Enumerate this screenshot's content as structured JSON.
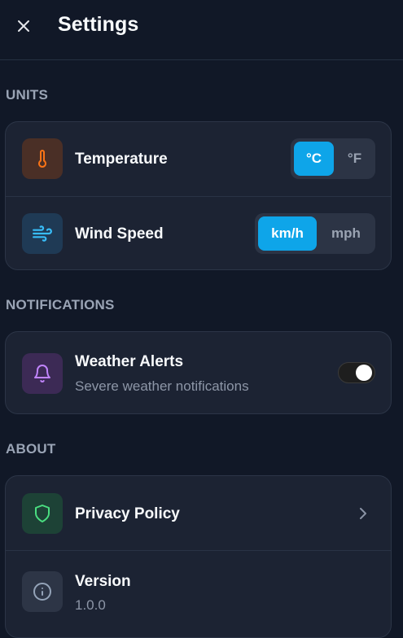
{
  "header": {
    "title": "Settings",
    "close_icon": "close-icon"
  },
  "sections": {
    "units": {
      "label": "UNITS",
      "temperature": {
        "label": "Temperature",
        "icon": "thermometer-icon",
        "options": [
          "°C",
          "°F"
        ],
        "selected": "°C"
      },
      "wind_speed": {
        "label": "Wind Speed",
        "icon": "wind-icon",
        "options": [
          "km/h",
          "mph"
        ],
        "selected": "km/h"
      }
    },
    "notifications": {
      "label": "NOTIFICATIONS",
      "weather_alerts": {
        "label": "Weather Alerts",
        "description": "Severe weather notifications",
        "icon": "bell-icon",
        "enabled": true
      }
    },
    "about": {
      "label": "ABOUT",
      "privacy_policy": {
        "label": "Privacy Policy",
        "icon": "shield-icon"
      },
      "version": {
        "label": "Version",
        "value": "1.0.0",
        "icon": "info-icon"
      }
    }
  },
  "colors": {
    "background": "#111827",
    "card": "#1c2333",
    "accent": "#0ea5e9",
    "temperature_icon": "#f97316",
    "wind_icon": "#38bdf8",
    "bell_icon": "#c084fc",
    "shield_icon": "#4ade80",
    "info_icon": "#94a3b8"
  }
}
